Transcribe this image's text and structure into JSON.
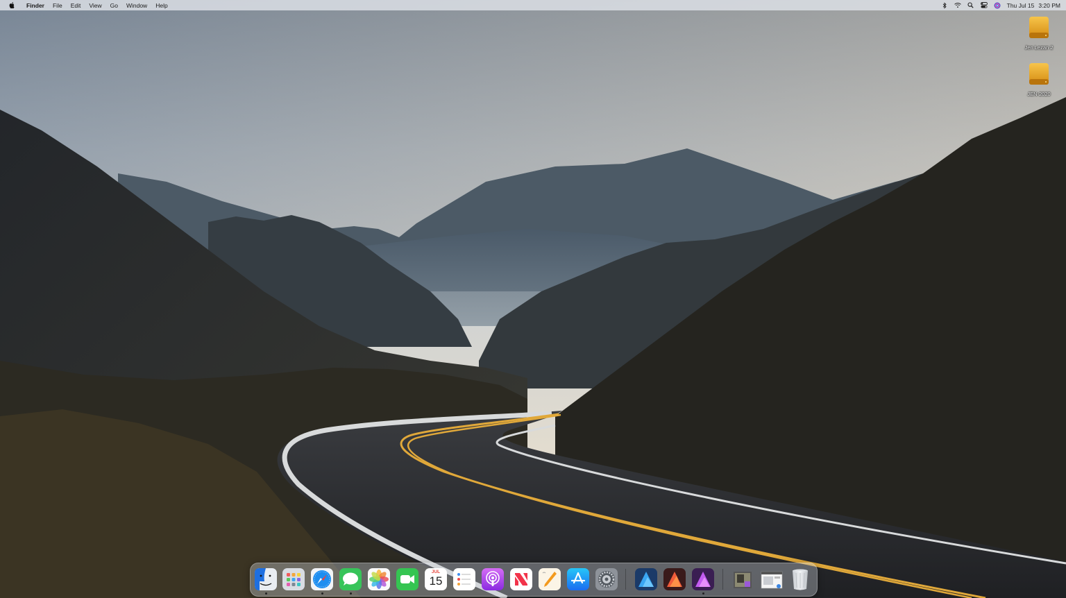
{
  "menubar": {
    "app_name": "Finder",
    "items": [
      "File",
      "Edit",
      "View",
      "Go",
      "Window",
      "Help"
    ],
    "status_icons": [
      "bluetooth-icon",
      "wifi-icon",
      "spotlight-search-icon",
      "control-center-icon",
      "siri-icon"
    ],
    "date": "Thu Jul 15",
    "time": "3:20 PM"
  },
  "desktop": {
    "icons": [
      {
        "label": "Jen Lezan 2",
        "icon": "external-drive-icon"
      },
      {
        "label": "JEN-2020",
        "icon": "external-drive-icon"
      }
    ]
  },
  "dock": {
    "apps": [
      {
        "name": "Finder",
        "icon": "finder-icon",
        "running": true
      },
      {
        "name": "Launchpad",
        "icon": "launchpad-icon",
        "running": false
      },
      {
        "name": "Safari",
        "icon": "safari-icon",
        "running": true
      },
      {
        "name": "Messages",
        "icon": "messages-icon",
        "running": true
      },
      {
        "name": "Photos",
        "icon": "photos-icon",
        "running": false
      },
      {
        "name": "FaceTime",
        "icon": "facetime-icon",
        "running": false
      },
      {
        "name": "Calendar",
        "icon": "calendar-icon",
        "running": false
      },
      {
        "name": "Reminders",
        "icon": "reminders-icon",
        "running": false
      },
      {
        "name": "Podcasts",
        "icon": "podcasts-icon",
        "running": false
      },
      {
        "name": "News",
        "icon": "news-icon",
        "running": false
      },
      {
        "name": "Pages",
        "icon": "pages-icon",
        "running": false
      },
      {
        "name": "App Store",
        "icon": "app-store-icon",
        "running": false
      },
      {
        "name": "System Preferences",
        "icon": "system-preferences-icon",
        "running": false
      },
      {
        "name": "Affinity Designer",
        "icon": "affinity-designer-icon",
        "running": false
      },
      {
        "name": "Affinity Publisher",
        "icon": "affinity-publisher-icon",
        "running": false
      },
      {
        "name": "Affinity Photo",
        "icon": "affinity-photo-icon",
        "running": true
      }
    ],
    "calendar": {
      "month": "JUL",
      "day": "15"
    },
    "stacks": [
      {
        "name": "Downloads stack",
        "icon": "downloads-stack-icon"
      },
      {
        "name": "Documents stack",
        "icon": "documents-stack-icon"
      }
    ],
    "trash": {
      "name": "Trash",
      "icon": "trash-icon"
    }
  }
}
